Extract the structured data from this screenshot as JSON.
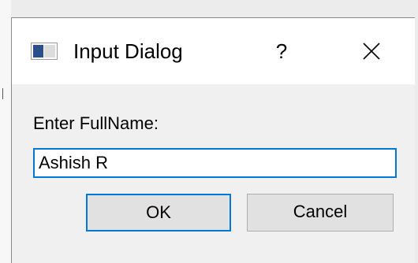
{
  "dialog": {
    "title": "Input Dialog",
    "icon": "window-app-icon",
    "help_glyph": "?",
    "close_icon": "close-icon"
  },
  "form": {
    "prompt": "Enter FullName:",
    "value": "Ashish R"
  },
  "buttons": {
    "ok_label": "OK",
    "cancel_label": "Cancel"
  },
  "colors": {
    "accent": "#0078d7",
    "title_bg": "#ffffff",
    "dialog_bg": "#f0f0f0",
    "button_bg": "#e1e1e1"
  }
}
